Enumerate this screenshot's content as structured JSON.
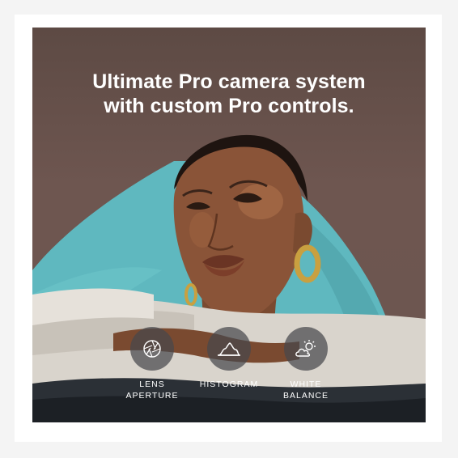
{
  "headline": {
    "line1": "Ultimate Pro camera system",
    "line2": "with custom Pro controls."
  },
  "controls": [
    {
      "label": "LENS\nAPERTURE",
      "icon": "aperture-icon"
    },
    {
      "label": "HISTOGRAM",
      "icon": "histogram-icon"
    },
    {
      "label": "WHITE\nBALANCE",
      "icon": "sun-cloud-icon"
    }
  ],
  "colors": {
    "background": "#6c5650",
    "turquoise": "#5fb8bf",
    "skin": "#8a5438",
    "sweater": "#d9d4cc",
    "text": "#ffffff"
  }
}
